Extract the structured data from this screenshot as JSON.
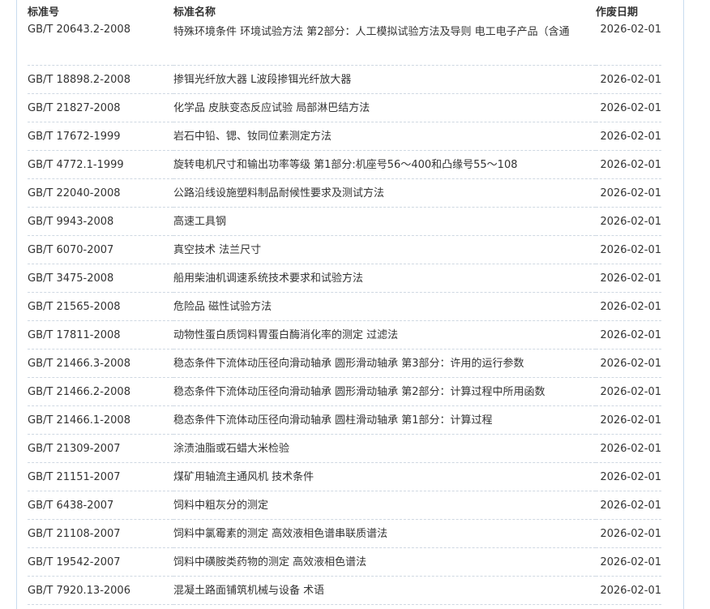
{
  "header": {
    "code": "标准号",
    "name": "标准名称",
    "date": "作废日期"
  },
  "rows": [
    {
      "code": "GB/T 20643.2-2008",
      "name": "特殊环境条件 环境试验方法 第2部分：人工模拟试验方法及导则 电工电子产品（含通",
      "date": "2026-02-01"
    },
    {
      "code": "GB/T 18898.2-2008",
      "name": "掺铒光纤放大器 L波段掺铒光纤放大器",
      "date": "2026-02-01"
    },
    {
      "code": "GB/T 21827-2008",
      "name": "化学品 皮肤变态反应试验 局部淋巴结方法",
      "date": "2026-02-01"
    },
    {
      "code": "GB/T 17672-1999",
      "name": "岩石中铅、锶、钕同位素测定方法",
      "date": "2026-02-01"
    },
    {
      "code": "GB/T 4772.1-1999",
      "name": "旋转电机尺寸和输出功率等级 第1部分:机座号56～400和凸缘号55～108",
      "date": "2026-02-01"
    },
    {
      "code": "GB/T 22040-2008",
      "name": "公路沿线设施塑料制品耐候性要求及测试方法",
      "date": "2026-02-01"
    },
    {
      "code": "GB/T 9943-2008",
      "name": "高速工具钢",
      "date": "2026-02-01"
    },
    {
      "code": "GB/T 6070-2007",
      "name": "真空技术 法兰尺寸",
      "date": "2026-02-01"
    },
    {
      "code": "GB/T 3475-2008",
      "name": "船用柴油机调速系统技术要求和试验方法",
      "date": "2026-02-01"
    },
    {
      "code": "GB/T 21565-2008",
      "name": "危险品 磁性试验方法",
      "date": "2026-02-01"
    },
    {
      "code": "GB/T 17811-2008",
      "name": "动物性蛋白质饲料胃蛋白酶消化率的测定 过滤法",
      "date": "2026-02-01"
    },
    {
      "code": "GB/T 21466.3-2008",
      "name": "稳态条件下流体动压径向滑动轴承 圆形滑动轴承 第3部分：许用的运行参数",
      "date": "2026-02-01"
    },
    {
      "code": "GB/T 21466.2-2008",
      "name": "稳态条件下流体动压径向滑动轴承 圆形滑动轴承 第2部分：计算过程中所用函数",
      "date": "2026-02-01"
    },
    {
      "code": "GB/T 21466.1-2008",
      "name": "稳态条件下流体动压径向滑动轴承 圆柱滑动轴承 第1部分：计算过程",
      "date": "2026-02-01"
    },
    {
      "code": "GB/T 21309-2007",
      "name": "涂渍油脂或石蜡大米检验",
      "date": "2026-02-01"
    },
    {
      "code": "GB/T 21151-2007",
      "name": "煤矿用轴流主通风机 技术条件",
      "date": "2026-02-01"
    },
    {
      "code": "GB/T 6438-2007",
      "name": "饲料中粗灰分的测定",
      "date": "2026-02-01"
    },
    {
      "code": "GB/T 21108-2007",
      "name": "饲料中氯霉素的测定 高效液相色谱串联质谱法",
      "date": "2026-02-01"
    },
    {
      "code": "GB/T 19542-2007",
      "name": "饲料中磺胺类药物的测定 高效液相色谱法",
      "date": "2026-02-01"
    },
    {
      "code": "GB/T 7920.13-2006",
      "name": "混凝土路面铺筑机械与设备 术语",
      "date": "2026-02-01"
    }
  ]
}
